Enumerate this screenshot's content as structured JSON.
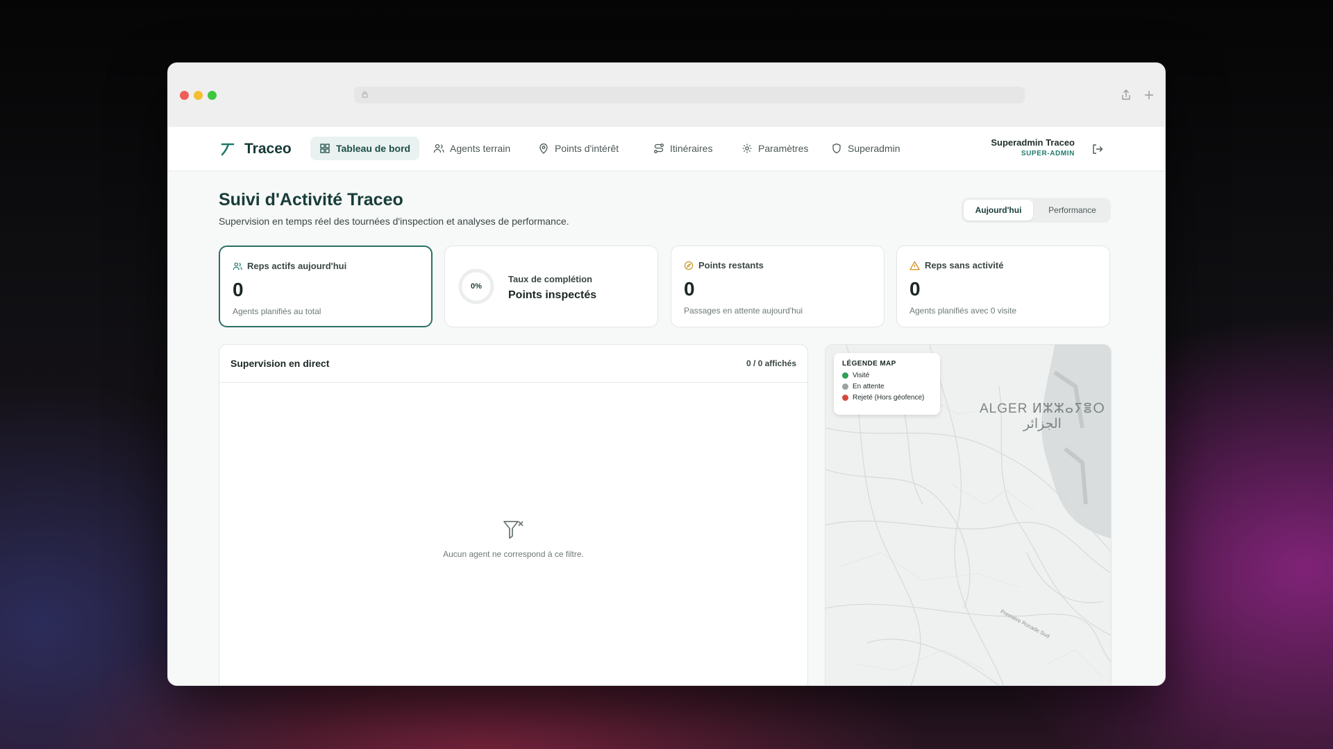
{
  "app": {
    "name": "Traceo"
  },
  "nav": {
    "items": [
      {
        "label": "Tableau de bord"
      },
      {
        "label": "Agents terrain"
      },
      {
        "label": "Points d'intérêt"
      },
      {
        "label": "Itinéraires"
      },
      {
        "label": "Paramètres"
      },
      {
        "label": "Superadmin"
      }
    ]
  },
  "user": {
    "name": "Superadmin Traceo",
    "role": "SUPER-ADMIN"
  },
  "page": {
    "title": "Suivi d'Activité Traceo",
    "subtitle": "Supervision en temps réel des tournées d'inspection et analyses de performance.",
    "tabs": [
      "Aujourd'hui",
      "Performance"
    ]
  },
  "cards": {
    "active": {
      "title": "Reps actifs aujourd'hui",
      "value": "0",
      "desc": "Agents planifiés au total"
    },
    "completion": {
      "percent": "0%",
      "title": "Taux de complétion",
      "subtitle": "Points inspectés"
    },
    "remaining": {
      "title": "Points restants",
      "value": "0",
      "desc": "Passages en attente aujourd'hui"
    },
    "inactive": {
      "title": "Reps sans activité",
      "value": "0",
      "desc": "Agents planifiés avec 0 visite"
    }
  },
  "live": {
    "title": "Supervision en direct",
    "count": "0 / 0 affichés",
    "empty": "Aucun agent ne correspond à ce filtre."
  },
  "map": {
    "legend_title": "LÉGENDE MAP",
    "legend": [
      {
        "label": "Visité",
        "color": "#2e9d57"
      },
      {
        "label": "En attente",
        "color": "#9ca3a2"
      },
      {
        "label": "Rejeté (Hors géofence)",
        "color": "#d24a3e"
      }
    ],
    "city_latin": "ALGER ⵍⵣⵣⴰⵢⴻⵔ",
    "city_arabic": "الجزائر",
    "road_label": "Première Rocade Sud"
  },
  "colors": {
    "accent": "#1d4d46",
    "brand": "#173d38"
  }
}
